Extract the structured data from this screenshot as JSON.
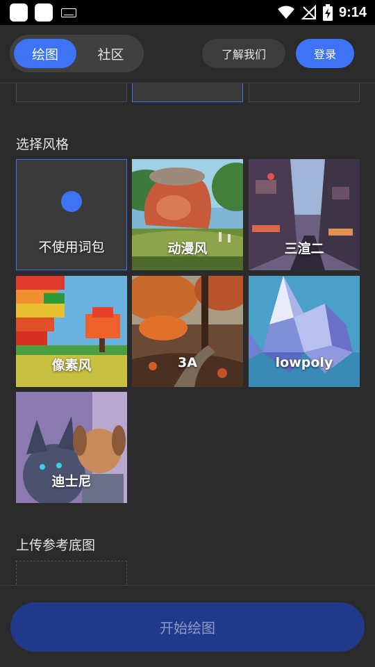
{
  "status_bar": {
    "time": "9:14"
  },
  "header": {
    "tabs": [
      {
        "label": "绘图"
      },
      {
        "label": "社区"
      }
    ],
    "about_label": "了解我们",
    "login_label": "登录"
  },
  "colors": {
    "accent": "#3f73f6",
    "background": "#2b2b2b",
    "card": "#3a3a3a"
  },
  "style_section": {
    "title": "选择风格",
    "styles": [
      {
        "label": "不使用词包",
        "selected": true
      },
      {
        "label": "动漫风"
      },
      {
        "label": "三渲二"
      },
      {
        "label": "像素风"
      },
      {
        "label": "3A"
      },
      {
        "label": "lowpoly"
      },
      {
        "label": "迪士尼"
      }
    ]
  },
  "upload_section": {
    "title": "上传参考底图"
  },
  "start_button": {
    "label": "开始绘图"
  }
}
